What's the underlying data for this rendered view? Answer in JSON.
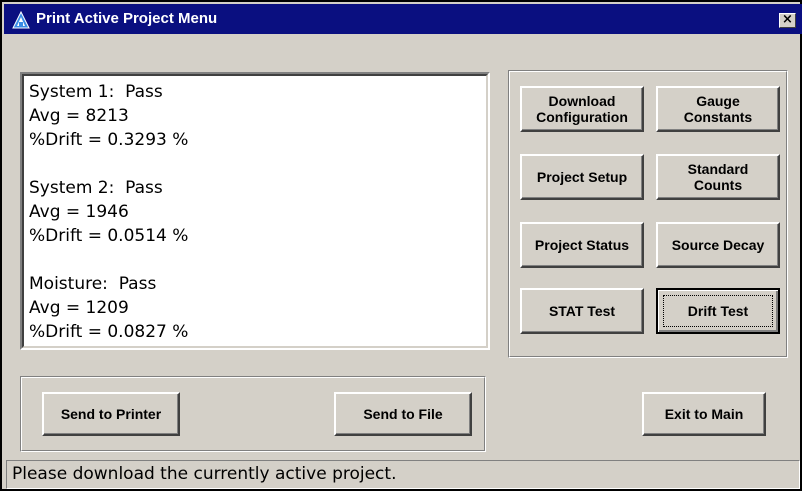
{
  "window": {
    "title": "Print Active Project Menu",
    "close_label": "×"
  },
  "results": {
    "lines": [
      "System 1:  Pass",
      "Avg = 8213",
      "%Drift = 0.3293 %",
      "",
      "System 2:  Pass",
      "Avg = 1946",
      "%Drift = 0.0514 %",
      "",
      "Moisture:  Pass",
      "Avg = 1209",
      "%Drift = 0.0827 %"
    ]
  },
  "buttons": {
    "download_configuration": "Download\nConfiguration",
    "gauge_constants": "Gauge\nConstants",
    "project_setup": "Project Setup",
    "standard_counts": "Standard\nCounts",
    "project_status": "Project Status",
    "source_decay": "Source Decay",
    "stat_test": "STAT Test",
    "drift_test": "Drift Test",
    "send_to_printer": "Send to Printer",
    "send_to_file": "Send to File",
    "exit_to_main": "Exit to Main"
  },
  "status": {
    "message": "Please download the currently active project."
  },
  "colors": {
    "titlebar": "#0a0f80",
    "face": "#d4d0c8",
    "logo": "#3a8ee6"
  }
}
